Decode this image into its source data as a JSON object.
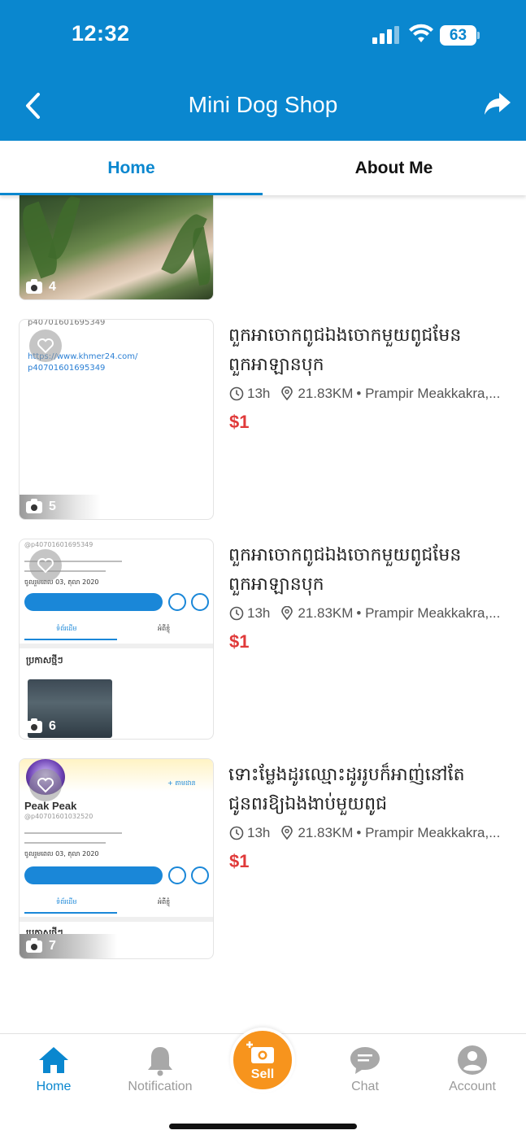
{
  "status_bar": {
    "time": "12:32",
    "battery": "63"
  },
  "header": {
    "title": "Mini Dog Shop"
  },
  "tabs": [
    {
      "label": "Home"
    },
    {
      "label": "About Me"
    }
  ],
  "listings": [
    {
      "photo_count": "4"
    },
    {
      "photo_count": "5",
      "title_line1": "ពួកអាចោកពូជឯងចោកមួយពូជមែន",
      "title_line2": "ពួកអាឡានបុក",
      "age": "13h",
      "distance": "21.83KM",
      "location": "• Prampir Meakkakra,...",
      "price": "$1",
      "thumb_text_1": "p40701601695349",
      "thumb_text_2": "https://www.khmer24.com/",
      "thumb_text_3": "p40701601695349"
    },
    {
      "photo_count": "6",
      "title_line1": "ពួកអាចោកពូជឯងចោកមួយពូជមែន",
      "title_line2": "ពួកអាឡានបុក",
      "age": "13h",
      "distance": "21.83KM",
      "location": "• Prampir Meakkakra,...",
      "price": "$1",
      "thumb_handle": "@p40701601695349",
      "thumb_date": "ចូលរួមពេល 03, តុលា 2020",
      "thumb_tab_1": "ទំព័រដើម",
      "thumb_tab_2": "អំពីខ្ញុំ",
      "thumb_section": "ប្រកាសថ្មីៗ"
    },
    {
      "photo_count": "7",
      "title_line1": "ទោះម្លែងដូរឈ្មោះដូររូបក៏អាញ់នៅតែ",
      "title_line2": "ជូនពរឱ្យឯងងាប់មួយពូជ",
      "age": "13h",
      "distance": "21.83KM",
      "location": "• Prampir Meakkakra,...",
      "price": "$1",
      "thumb_name": "Peak Peak",
      "thumb_handle": "@p40701601032520",
      "thumb_date": "ចូលរួមពេល 03, តុលា 2020",
      "thumb_tab_1": "ទំព័រដើម",
      "thumb_tab_2": "អំពីខ្ញុំ",
      "thumb_section": "ប្រកាសថ្មីៗ"
    }
  ],
  "bottom_nav": {
    "home": "Home",
    "notification": "Notification",
    "sell": "Sell",
    "chat": "Chat",
    "account": "Account"
  },
  "colors": {
    "brand": "#0a87cf",
    "price": "#e03a3a",
    "sell": "#f7941d"
  }
}
